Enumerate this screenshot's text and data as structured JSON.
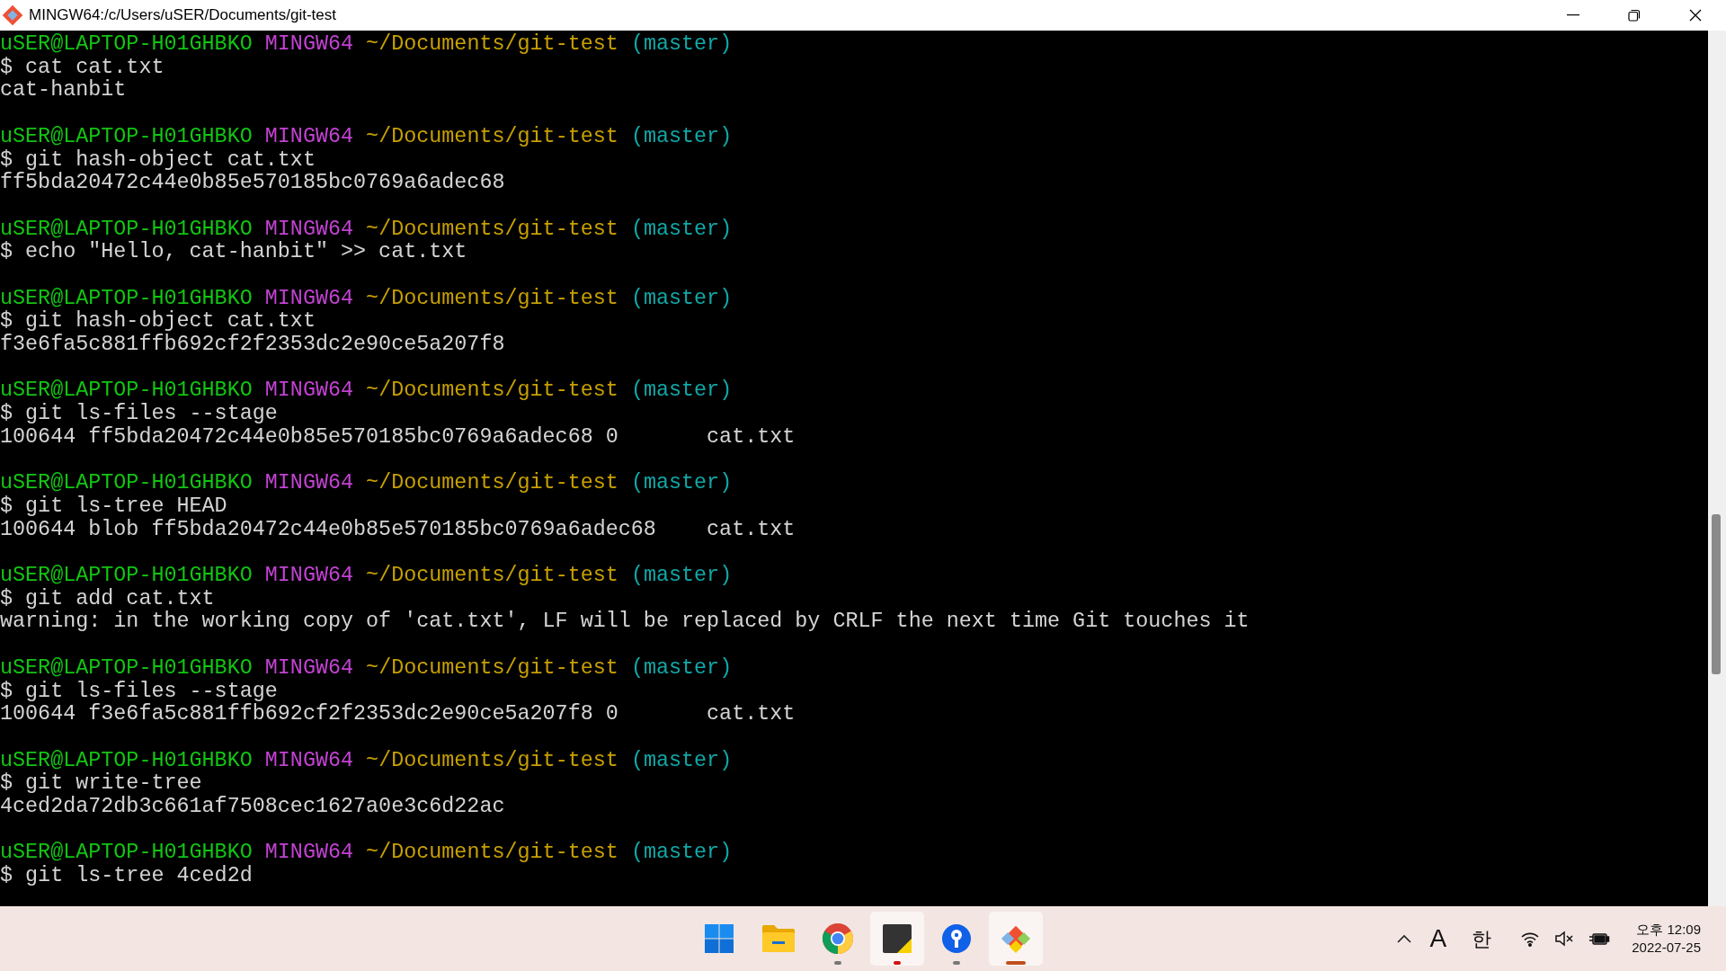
{
  "window": {
    "title": "MINGW64:/c/Users/uSER/Documents/git-test"
  },
  "terminal": {
    "blocks": [
      {
        "prompt": {
          "user_host": "uSER@LAPTOP-H01GHBKO",
          "system": "MINGW64",
          "path": "~/Documents/git-test",
          "branch": "(master)"
        },
        "command": "$ cat cat.txt",
        "output": [
          "cat-hanbit"
        ]
      },
      {
        "prompt": {
          "user_host": "uSER@LAPTOP-H01GHBKO",
          "system": "MINGW64",
          "path": "~/Documents/git-test",
          "branch": "(master)"
        },
        "command": "$ git hash-object cat.txt",
        "output": [
          "ff5bda20472c44e0b85e570185bc0769a6adec68"
        ]
      },
      {
        "prompt": {
          "user_host": "uSER@LAPTOP-H01GHBKO",
          "system": "MINGW64",
          "path": "~/Documents/git-test",
          "branch": "(master)"
        },
        "command": "$ echo \"Hello, cat-hanbit\" >> cat.txt"
      },
      {
        "prompt": {
          "user_host": "uSER@LAPTOP-H01GHBKO",
          "system": "MINGW64",
          "path": "~/Documents/git-test",
          "branch": "(master)"
        },
        "command": "$ git hash-object cat.txt",
        "output": [
          "f3e6fa5c881ffb692cf2f2353dc2e90ce5a207f8"
        ]
      },
      {
        "prompt": {
          "user_host": "uSER@LAPTOP-H01GHBKO",
          "system": "MINGW64",
          "path": "~/Documents/git-test",
          "branch": "(master)"
        },
        "command": "$ git ls-files --stage",
        "output": [
          "100644 ff5bda20472c44e0b85e570185bc0769a6adec68 0\tcat.txt"
        ]
      },
      {
        "prompt": {
          "user_host": "uSER@LAPTOP-H01GHBKO",
          "system": "MINGW64",
          "path": "~/Documents/git-test",
          "branch": "(master)"
        },
        "command": "$ git ls-tree HEAD",
        "output": [
          "100644 blob ff5bda20472c44e0b85e570185bc0769a6adec68\tcat.txt"
        ]
      },
      {
        "prompt": {
          "user_host": "uSER@LAPTOP-H01GHBKO",
          "system": "MINGW64",
          "path": "~/Documents/git-test",
          "branch": "(master)"
        },
        "command": "$ git add cat.txt",
        "output": [
          "warning: in the working copy of 'cat.txt', LF will be replaced by CRLF the next time Git touches it"
        ]
      },
      {
        "prompt": {
          "user_host": "uSER@LAPTOP-H01GHBKO",
          "system": "MINGW64",
          "path": "~/Documents/git-test",
          "branch": "(master)"
        },
        "command": "$ git ls-files --stage",
        "output": [
          "100644 f3e6fa5c881ffb692cf2f2353dc2e90ce5a207f8 0\tcat.txt"
        ]
      },
      {
        "prompt": {
          "user_host": "uSER@LAPTOP-H01GHBKO",
          "system": "MINGW64",
          "path": "~/Documents/git-test",
          "branch": "(master)"
        },
        "command": "$ git write-tree",
        "output": [
          "4ced2da72db3c661af7508cec1627a0e3c6d22ac"
        ]
      },
      {
        "prompt": {
          "user_host": "uSER@LAPTOP-H01GHBKO",
          "system": "MINGW64",
          "path": "~/Documents/git-test",
          "branch": "(master)"
        },
        "command": "$ git ls-tree 4ced2d"
      }
    ]
  },
  "taskbar": {
    "apps": [
      {
        "kind": "start",
        "running": false,
        "selected": false
      },
      {
        "kind": "files",
        "running": false,
        "selected": false
      },
      {
        "kind": "browser",
        "running": true,
        "selected": false
      },
      {
        "kind": "notes",
        "running": true,
        "selected": true
      },
      {
        "kind": "keyhole",
        "running": true,
        "selected": false
      },
      {
        "kind": "git",
        "running": true,
        "selected": true
      }
    ],
    "ime_mode": "A",
    "ime_lang": "한",
    "time": "오후 12:09",
    "date": "2022-07-25"
  }
}
